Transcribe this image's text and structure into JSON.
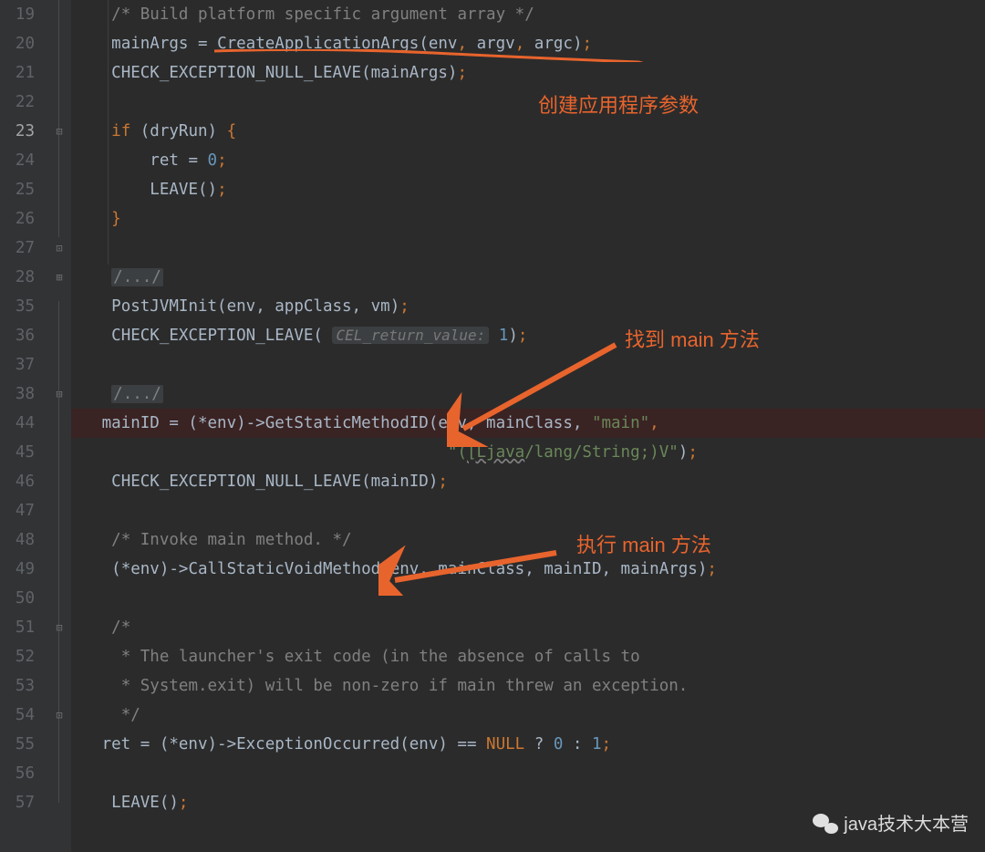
{
  "line_numbers": [
    "19",
    "20",
    "21",
    "22",
    "23",
    "24",
    "25",
    "26",
    "27",
    "28",
    "35",
    "36",
    "37",
    "38",
    "44",
    "45",
    "46",
    "47",
    "48",
    "49",
    "50",
    "51",
    "52",
    "53",
    "54",
    "55",
    "56",
    "57"
  ],
  "current_line_index": 4,
  "breakpoint_line_index": 14,
  "code": {
    "l19": "/* Build platform specific argument array */",
    "l20_pre": "mainArgs = ",
    "l20_fn": "CreateApplicationArgs",
    "l20_post1": "(env",
    "l20_post2": " argv",
    "l20_post3": " argc)",
    "l21": "CHECK_EXCEPTION_NULL_LEAVE(mainArgs)",
    "l23_if": "if",
    "l23_cond": " (dryRun) ",
    "l24_a": "ret = ",
    "l24_n": "0",
    "l25": "LEAVE()",
    "fold": "/.../",
    "l35": "PostJVMInit(env, appClass, vm)",
    "l36_a": "CHECK_EXCEPTION_LEAVE( ",
    "l36_hint": "CEL_return_value:",
    "l36_n": "1",
    "l36_c": ")",
    "l44": "mainID = (*env)->GetStaticMethodID(env, mainClass, ",
    "l44_s": "\"main\"",
    "l45_s1": "\"(",
    "l45_w": "[Ljava",
    "l45_s2": "/lang/String;)V\"",
    "l45_c": ")",
    "l46": "CHECK_EXCEPTION_NULL_LEAVE(mainID)",
    "l48": "/* Invoke main method. */",
    "l49": "(*env)->CallStaticVoidMethod(env, mainClass, mainID, mainArgs)",
    "l51": "/*",
    "l52": " * The launcher's exit code (in the absence of calls to",
    "l53": " * System.exit) will be non-zero if main threw an exception.",
    "l54": " */",
    "l55_a": "ret = (*env)->ExceptionOccurred(env) == ",
    "l55_null": "NULL",
    "l55_b": " ? ",
    "l55_n0": "0",
    "l55_c": " : ",
    "l55_n1": "1",
    "l57": "LEAVE()"
  },
  "annotations": {
    "a1": "创建应用程序参数",
    "a2": "找到 main 方法",
    "a3": "执行 main 方法"
  },
  "watermark": "java技术大本营"
}
